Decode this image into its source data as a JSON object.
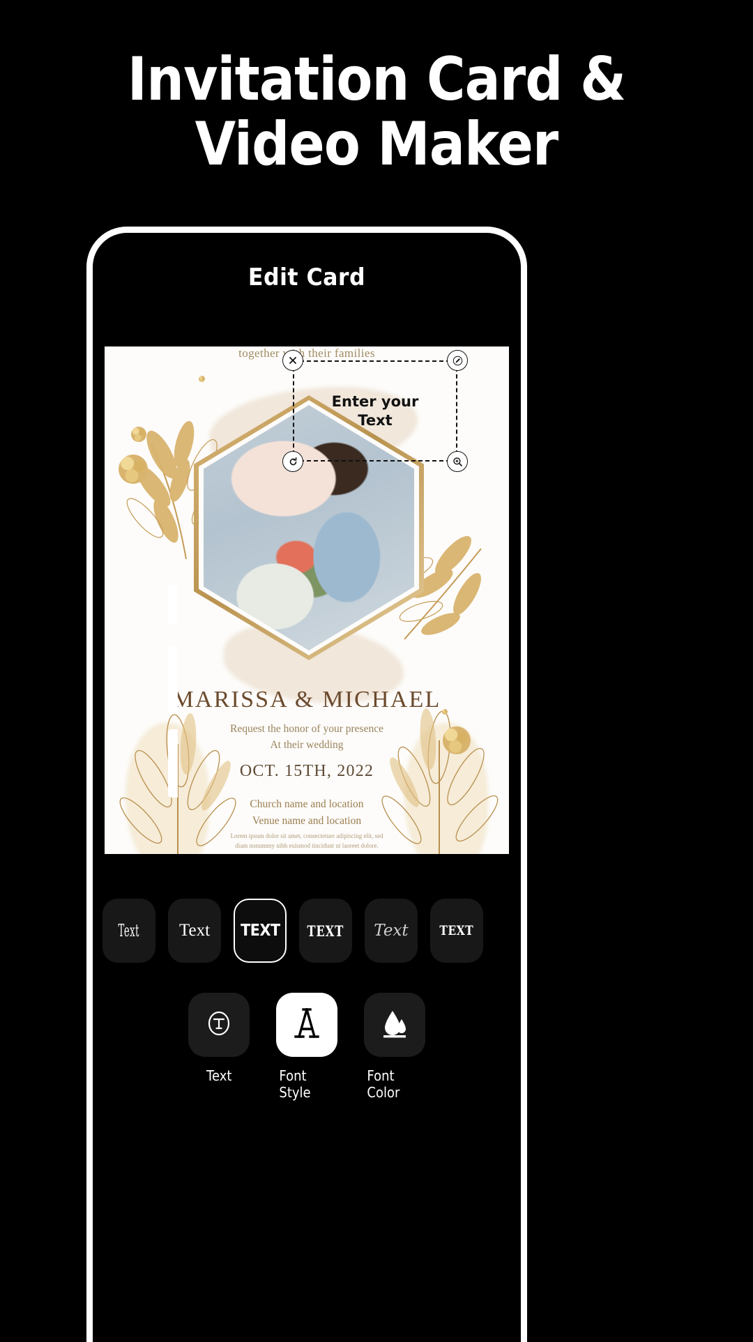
{
  "headline": {
    "line1": "Invitation Card &",
    "line2": "Video Maker"
  },
  "phone": {
    "screen_title": "Edit Card"
  },
  "card": {
    "top_text": "together with their families",
    "names": "MARISSA & MICHAEL",
    "request_line1": "Request the honor of your presence",
    "request_line2": "At their wedding",
    "date": "OCT. 15TH, 2022",
    "venue_line1": "Church name and location",
    "venue_line2": "Venue name and location",
    "fine_line1": "Lorem ipsum dolor sit amet, consectetuer adipiscing elit, sed",
    "fine_line2": "diam nonummy nibh euismod tincidunt ut laoreet dolore."
  },
  "text_overlay": {
    "placeholder_line1": "Enter your",
    "placeholder_line2": "Text",
    "handles": [
      {
        "name": "close-icon",
        "position": "top-left"
      },
      {
        "name": "edit-icon",
        "position": "top-right"
      },
      {
        "name": "rotate-icon",
        "position": "bottom-left"
      },
      {
        "name": "resize-icon",
        "position": "bottom-right"
      }
    ]
  },
  "font_chips": [
    {
      "label": "Text",
      "style": "condensed-serif",
      "selected": false
    },
    {
      "label": "Text",
      "style": "serif",
      "selected": false
    },
    {
      "label": "TEXT",
      "style": "bold-sans-caps",
      "selected": true
    },
    {
      "label": "TEXT",
      "style": "stencil-caps",
      "selected": false
    },
    {
      "label": "Text",
      "style": "script-italic",
      "selected": false
    },
    {
      "label": "TEXT",
      "style": "slab-western-caps",
      "selected": false
    }
  ],
  "toolbar": [
    {
      "label": "Text",
      "icon": "circled-t-icon",
      "active": false
    },
    {
      "label": "Font Style",
      "icon": "letter-a-icon",
      "active": true
    },
    {
      "label": "Font Color",
      "icon": "ink-drop-icon",
      "active": false
    }
  ],
  "colors": {
    "background": "#000000",
    "accent_gold": "#c9a css",
    "card_bg": "#fdfcfa",
    "names_color": "#6b4a2d",
    "body_gold": "#9a835c"
  }
}
